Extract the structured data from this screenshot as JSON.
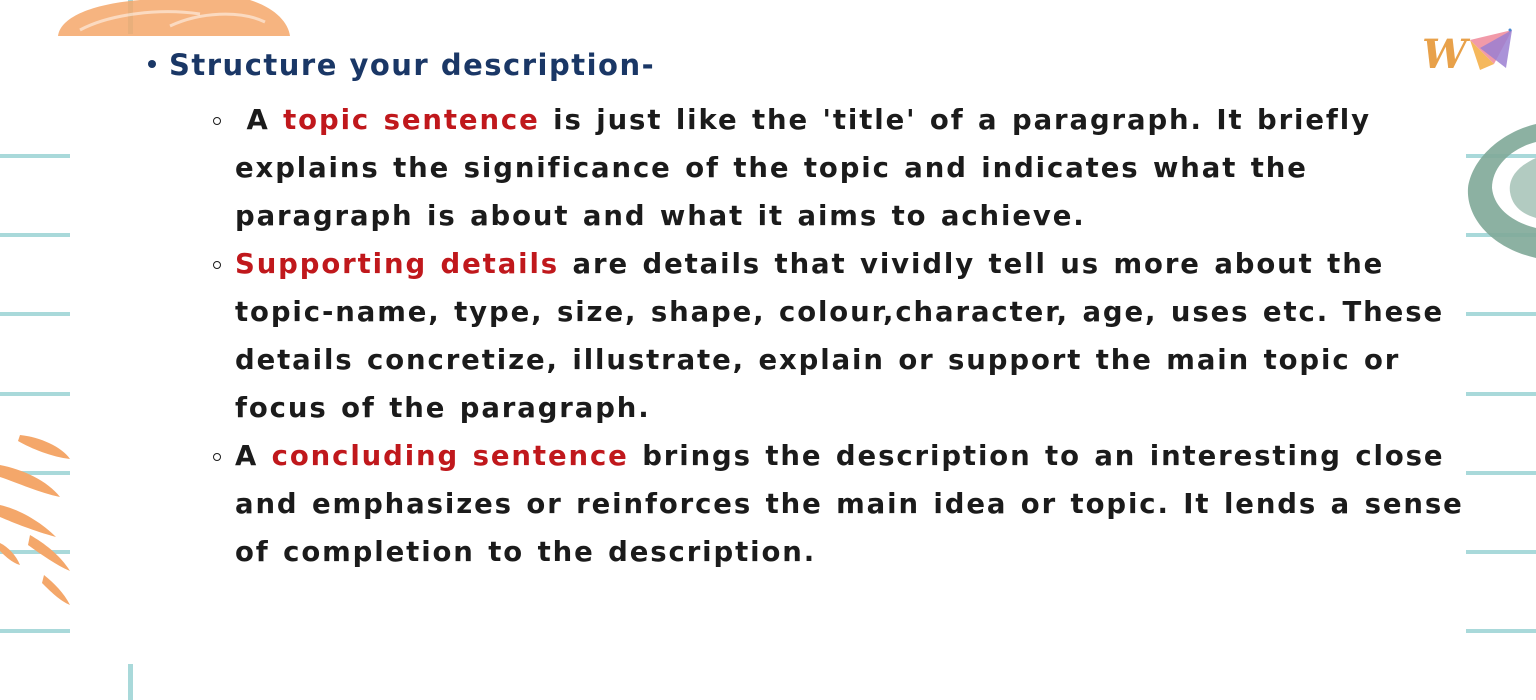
{
  "heading": "Structure your description-",
  "items": [
    {
      "pre": " A ",
      "highlight": "topic sentence",
      "post": " is just like the 'title' of a paragraph. It briefly explains the significance of the topic and indicates what the paragraph is about and what it aims to achieve."
    },
    {
      "pre": "",
      "highlight": "Supporting details",
      "post": " are details that vividly tell us more about the topic-name, type, size, shape, colour,character, age, uses etc. These details concretize, illustrate, explain or support the main topic or focus of the paragraph."
    },
    {
      "pre": "A ",
      "highlight": "concluding sentence",
      "post": " brings the description to an interesting close and emphasizes or reinforces the main idea or topic. It lends a sense of completion to the description."
    }
  ],
  "colors": {
    "heading": "#1a3766",
    "highlight": "#c0181c",
    "body_text": "#1b1b1b",
    "rules": "#a9d9da",
    "orange_decoration": "#f4a76a",
    "green_decoration": "#7fa898"
  },
  "logo": {
    "icon": "logo-mark",
    "letter": "W"
  }
}
